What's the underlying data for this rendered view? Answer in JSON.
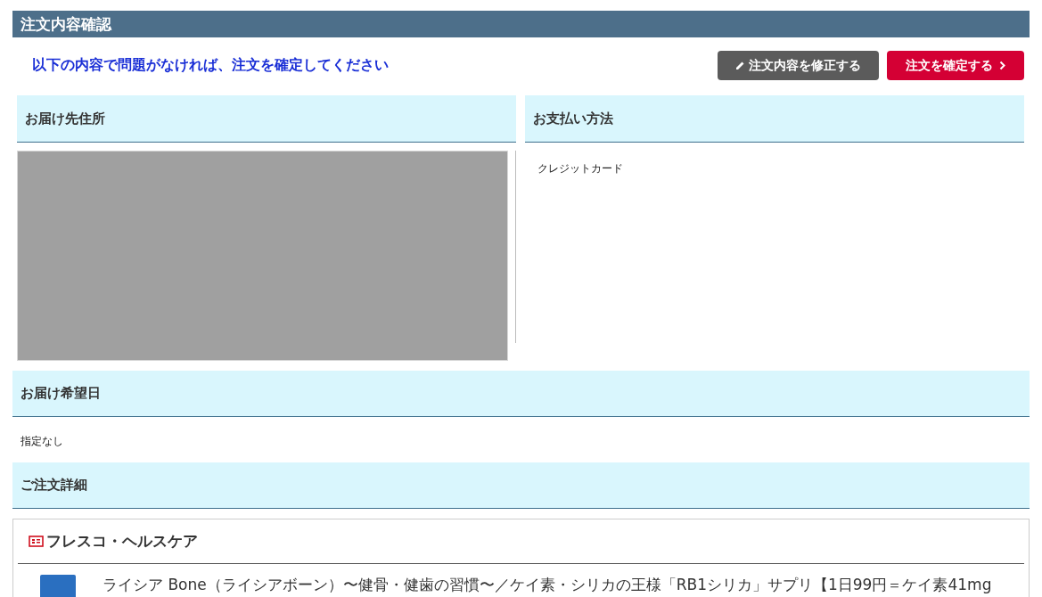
{
  "page_title": "注文内容確認",
  "instruction": "以下の内容で問題がなければ、注文を確定してください",
  "buttons": [
    {
      "kind": "edit",
      "label": "注文内容を修正する"
    },
    {
      "kind": "confirm",
      "label": "注文を確定する"
    }
  ],
  "shipping_address": {
    "heading": "お届け先住所"
  },
  "payment_method": {
    "heading": "お支払い方法",
    "value": "クレジットカード"
  },
  "delivery_date": {
    "heading": "お届け希望日",
    "value": "指定なし"
  },
  "order_details": {
    "heading": "ご注文詳細",
    "shop_name": "フレスコ・ヘルスケア",
    "items": [
      {
        "name": "ライシア Bone（ライシアボーン）〜健骨・健歯の習慣〜／ケイ素・シリカの王様「RB1シリカ」サプリ【1日99円＝ケイ素41mg"
      }
    ]
  }
}
